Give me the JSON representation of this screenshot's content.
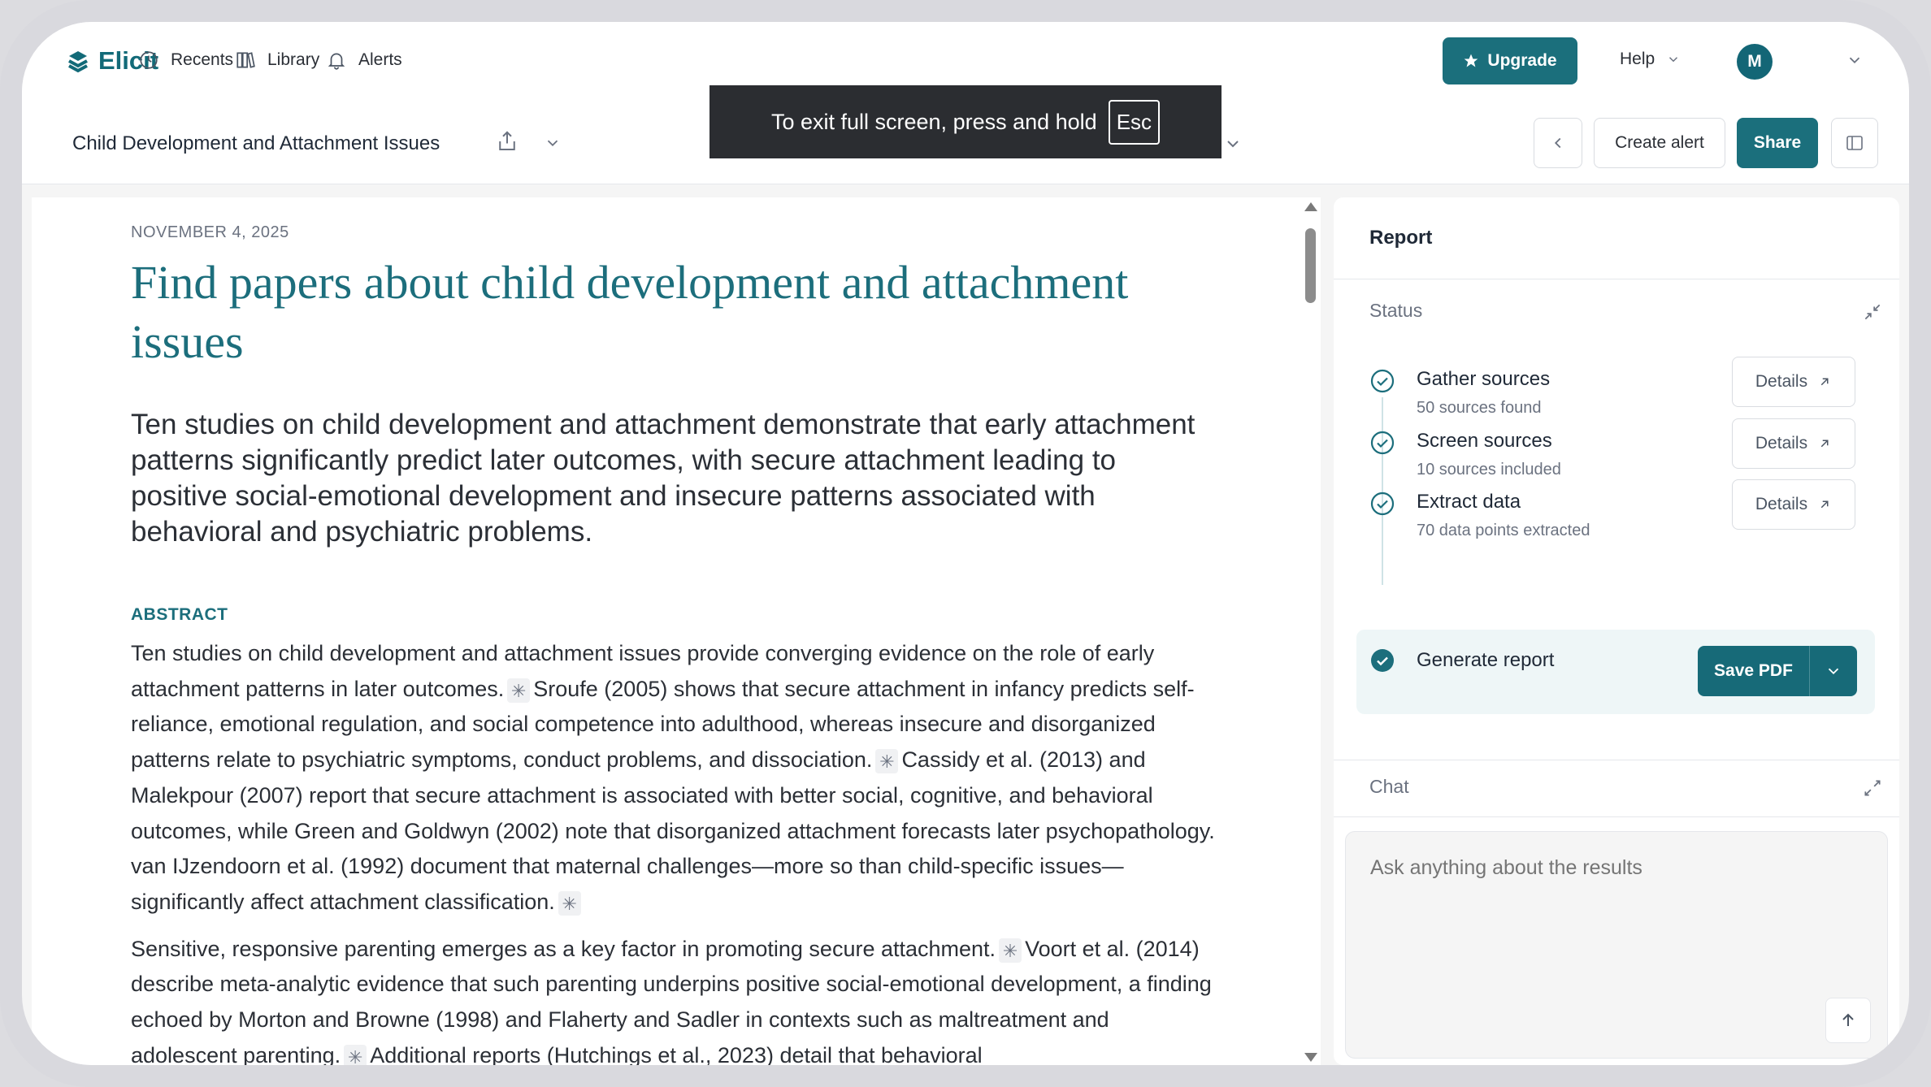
{
  "nav": {
    "logo": "Elicit",
    "recents": "Recents",
    "library": "Library",
    "alerts": "Alerts",
    "upgrade": "Upgrade",
    "help": "Help",
    "avatar_initial": "M"
  },
  "project": {
    "title": "Child Development and Attachment Issues",
    "create_alert": "Create alert",
    "share": "Share"
  },
  "fullscreen_toast": {
    "message": "To exit full screen, press and hold",
    "key": "Esc"
  },
  "document": {
    "date": "NOVEMBER 4, 2025",
    "title": "Find papers about child development and attachment issues",
    "summary": "Ten studies on child development and attachment demonstrate that early attachment patterns significantly predict later outcomes, with secure attachment leading to positive social-emotional development and insecure patterns associated with behavioral and psychiatric problems.",
    "abstract_heading": "ABSTRACT",
    "abstract_p1": [
      "Ten studies on child development and attachment issues provide converging evidence on the role of early attachment patterns in later outcomes.",
      "Sroufe (2005) shows that secure attachment in infancy predicts self-reliance, emotional regulation, and social competence into adulthood, whereas insecure and disorganized patterns relate to psychiatric symptoms, conduct problems, and dissociation.",
      "Cassidy et al. (2013) and Malekpour (2007) report that secure attachment is associated with better social, cognitive, and behavioral outcomes, while Green and Goldwyn (2002) note that disorganized attachment forecasts later psychopathology. van IJzendoorn et al. (1992) document that maternal challenges—more so than child-specific issues—significantly affect attachment classification."
    ],
    "abstract_p2": [
      "Sensitive, responsive parenting emerges as a key factor in promoting secure attachment.",
      "Voort et al. (2014) describe meta-analytic evidence that such parenting underpins positive social-emotional development, a finding echoed by Morton and Browne (1998) and Flaherty and Sadler in contexts such as maltreatment and adolescent parenting.",
      "Additional reports (Hutchings et al., 2023) detail that behavioral"
    ],
    "citation_glyph": "✳"
  },
  "report": {
    "title": "Report",
    "status_heading": "Status",
    "steps": [
      {
        "title": "Gather sources",
        "subtitle": "50 sources found",
        "action": "Details"
      },
      {
        "title": "Screen sources",
        "subtitle": "10 sources included",
        "action": "Details"
      },
      {
        "title": "Extract data",
        "subtitle": "70 data points extracted",
        "action": "Details"
      },
      {
        "title": "Generate report",
        "action": "Save PDF"
      }
    ],
    "chat_heading": "Chat",
    "chat_placeholder": "Ask anything about the results"
  },
  "colors": {
    "brand": "#1b6f7c",
    "title_teal": "#1c6e7c",
    "toast_bg": "#2b2d31"
  }
}
